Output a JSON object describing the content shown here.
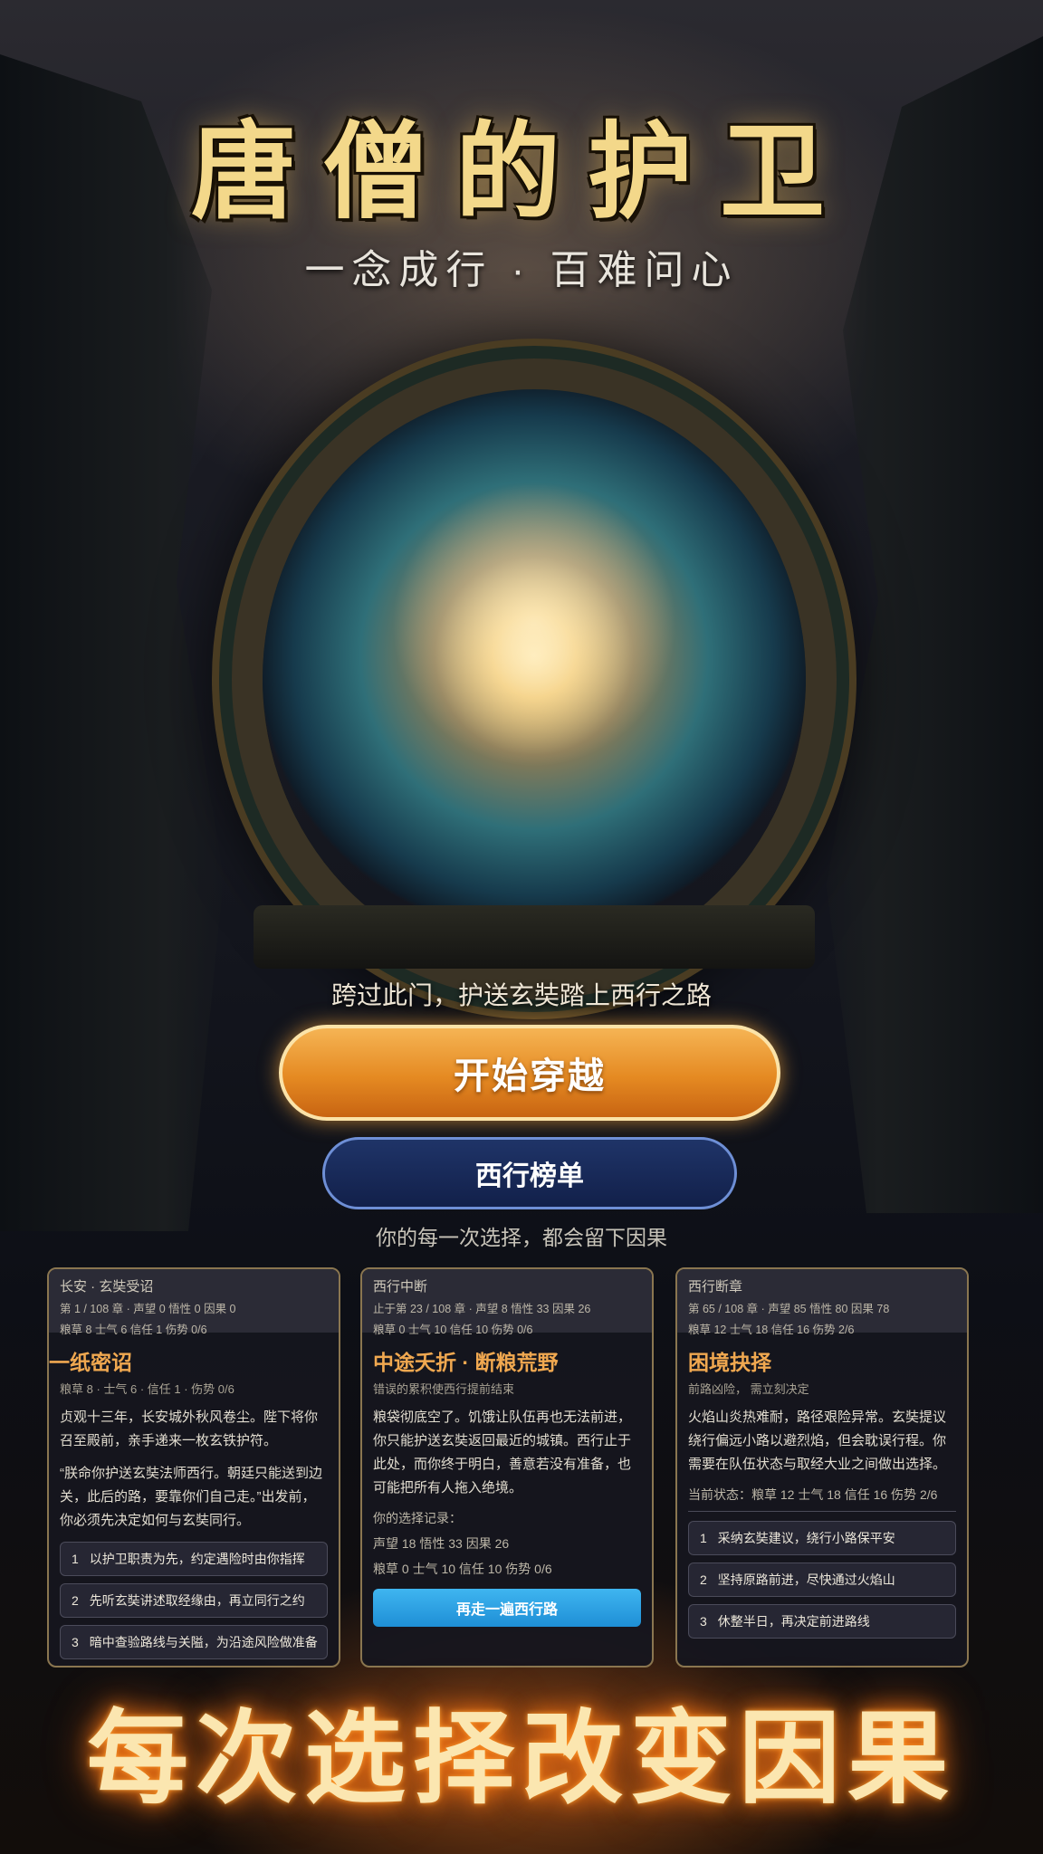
{
  "hero": {
    "title": "唐僧的护卫",
    "subtitle": "一念成行 · 百难问心",
    "tagline": "跨过此门，护送玄奘踏上西行之路",
    "start_button": "开始穿越",
    "rank_button": "西行榜单",
    "hint": "你的每一次选择，都会留下因果"
  },
  "cards": [
    {
      "head_title": "长安 · 玄奘受诏",
      "head_stat1": "第 1 / 108 章 · 声望 0  悟性 0  因果 0",
      "head_stat2": "粮草 8  士气 6  信任 1  伤势 0/6",
      "title": "一纸密诏",
      "sub": "粮草 8 · 士气 6 · 信任 1 · 伤势 0/6",
      "text1": "贞观十三年，长安城外秋风卷尘。陛下将你召至殿前，亲手递来一枚玄铁护符。",
      "text2": "“朕命你护送玄奘法师西行。朝廷只能送到边关，此后的路，要靠你们自己走。”出发前，你必须先决定如何与玄奘同行。",
      "choices": [
        {
          "num": "1",
          "label": "以护卫职责为先，约定遇险时由你指挥"
        },
        {
          "num": "2",
          "label": "先听玄奘讲述取经缘由，再立同行之约"
        },
        {
          "num": "3",
          "label": "暗中查验路线与关隘，为沿途风险做准备"
        }
      ]
    },
    {
      "head_title": "西行中断",
      "head_stat1": "止于第 23 / 108 章 · 声望 8  悟性 33  因果 26",
      "head_stat2": "粮草 0  士气 10  信任 10  伤势 0/6",
      "title": "中途夭折 · 断粮荒野",
      "sub": "错误的累积使西行提前结束",
      "text1": "粮袋彻底空了。饥饿让队伍再也无法前进，你只能护送玄奘返回最近的城镇。西行止于此处，而你终于明白，善意若没有准备，也可能把所有人拖入绝境。",
      "record_label": "你的选择记录：",
      "record1": "声望 18  悟性 33  因果 26",
      "record2": "粮草 0  士气 10  信任 10  伤势 0/6",
      "retry": "再走一遍西行路"
    },
    {
      "head_title": "西行断章",
      "head_stat1": "第 65 / 108 章 · 声望 85  悟性 80  因果 78",
      "head_stat2": "粮草 12  士气 18  信任 16  伤势 2/6",
      "title": "困境抉择",
      "sub": "前路凶险，   需立刻决定",
      "text1": "火焰山炎热难耐，路径艰险异常。玄奘提议绕行偏远小路以避烈焰，但会耽误行程。你需要在队伍状态与取经大业之间做出选择。",
      "status": "当前状态：粮草 12 士气 18 信任 16 伤势 2/6",
      "choices": [
        {
          "num": "1",
          "label": "采纳玄奘建议，绕行小路保平安"
        },
        {
          "num": "2",
          "label": "坚持原路前进，尽快通过火焰山"
        },
        {
          "num": "3",
          "label": "休整半日，再决定前进路线"
        }
      ]
    }
  ],
  "footer": "每次选择改变因果"
}
